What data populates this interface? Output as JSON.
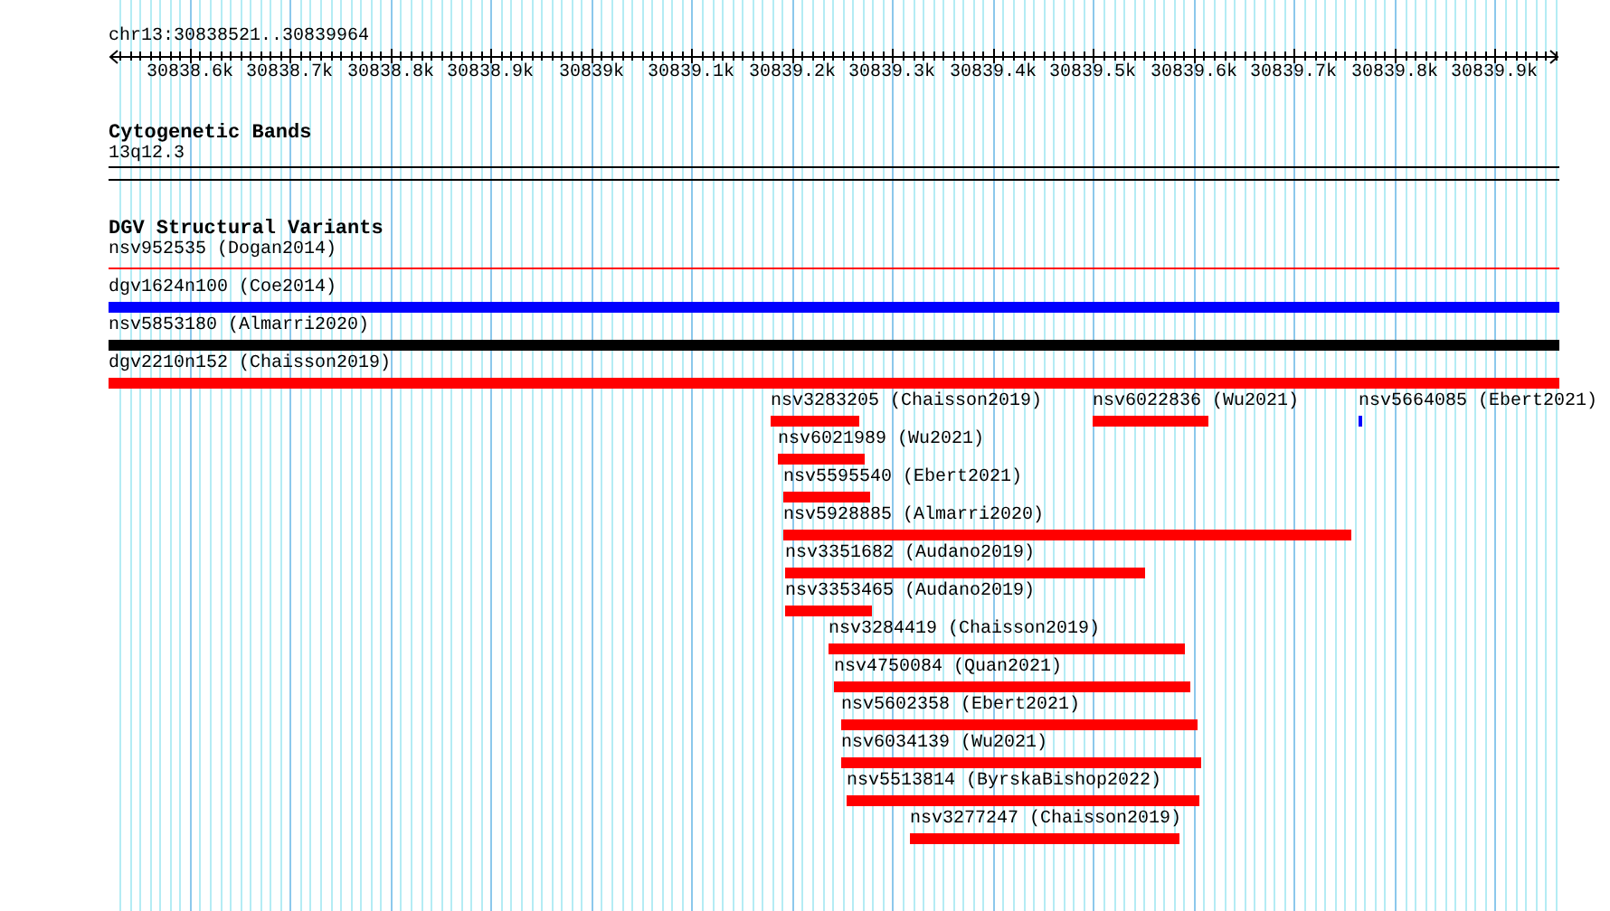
{
  "locus": "chr13:30838521..30839964",
  "ruler": {
    "ticks": [
      "30838.6k",
      "30838.7k",
      "30838.8k",
      "30838.9k",
      "30839k",
      "30839.1k",
      "30839.2k",
      "30839.3k",
      "30839.4k",
      "30839.5k",
      "30839.6k",
      "30839.7k",
      "30839.8k",
      "30839.9k"
    ]
  },
  "cytogenetic_track": {
    "title": "Cytogenetic Bands",
    "bands": [
      {
        "name": "13q12.3"
      }
    ]
  },
  "variant_track": {
    "title": "DGV Structural Variants",
    "features": [
      {
        "label": "nsv952535 (Dogan2014)",
        "kind": "line",
        "color": "#ff0000"
      },
      {
        "label": "dgv1624n100 (Coe2014)",
        "kind": "bar",
        "color": "#0000ff"
      },
      {
        "label": "nsv5853180 (Almarri2020)",
        "kind": "bar",
        "color": "#000000"
      },
      {
        "label": "dgv2210n152 (Chaisson2019)",
        "kind": "bar",
        "color": "#ff0000"
      },
      {
        "label": "nsv3283205 (Chaisson2019)",
        "kind": "bar",
        "color": "#ff0000"
      },
      {
        "label": "nsv6022836 (Wu2021)",
        "kind": "bar",
        "color": "#ff0000"
      },
      {
        "label": "nsv5664085 (Ebert2021)",
        "kind": "bar",
        "color": "#0000ff"
      },
      {
        "label": "nsv6021989 (Wu2021)",
        "kind": "bar",
        "color": "#ff0000"
      },
      {
        "label": "nsv5595540 (Ebert2021)",
        "kind": "bar",
        "color": "#ff0000"
      },
      {
        "label": "nsv5928885 (Almarri2020)",
        "kind": "bar",
        "color": "#ff0000"
      },
      {
        "label": "nsv3351682 (Audano2019)",
        "kind": "bar",
        "color": "#ff0000"
      },
      {
        "label": "nsv3353465 (Audano2019)",
        "kind": "bar",
        "color": "#ff0000"
      },
      {
        "label": "nsv3284419 (Chaisson2019)",
        "kind": "bar",
        "color": "#ff0000"
      },
      {
        "label": "nsv4750084 (Quan2021)",
        "kind": "bar",
        "color": "#ff0000"
      },
      {
        "label": "nsv5602358 (Ebert2021)",
        "kind": "bar",
        "color": "#ff0000"
      },
      {
        "label": "nsv6034139 (Wu2021)",
        "kind": "bar",
        "color": "#ff0000"
      },
      {
        "label": "nsv5513814 (ByrskaBishop2022)",
        "kind": "bar",
        "color": "#ff0000"
      },
      {
        "label": "nsv3277247 (Chaisson2019)",
        "kind": "bar",
        "color": "#ff0000"
      }
    ]
  }
}
